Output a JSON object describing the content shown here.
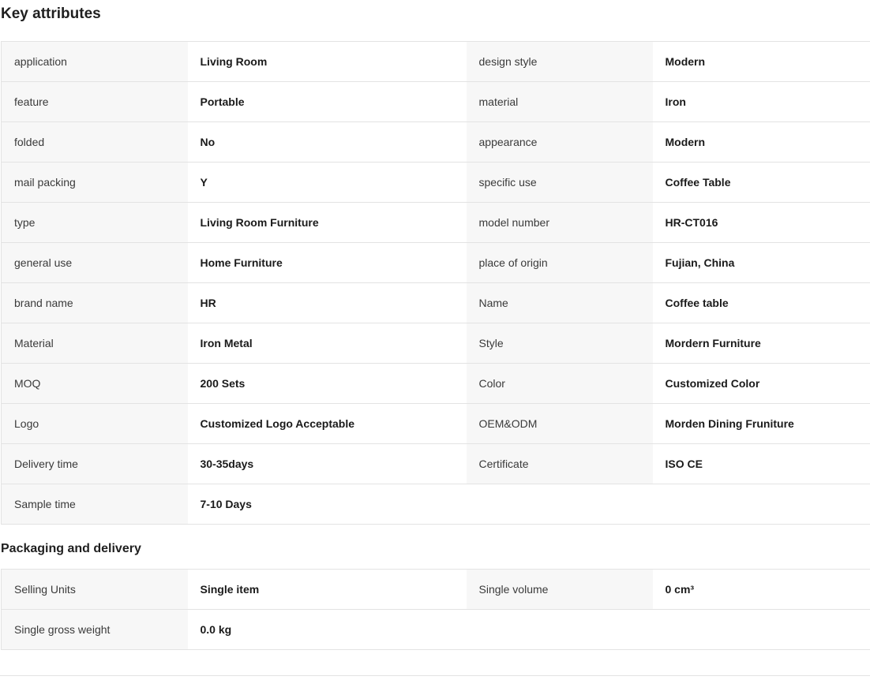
{
  "key_attributes": {
    "title": "Key attributes",
    "rows": [
      [
        {
          "k": "application",
          "v": "Living Room"
        },
        {
          "k": "design style",
          "v": "Modern"
        }
      ],
      [
        {
          "k": "feature",
          "v": "Portable"
        },
        {
          "k": "material",
          "v": "Iron"
        }
      ],
      [
        {
          "k": "folded",
          "v": "No"
        },
        {
          "k": "appearance",
          "v": "Modern"
        }
      ],
      [
        {
          "k": "mail packing",
          "v": "Y"
        },
        {
          "k": "specific use",
          "v": "Coffee Table"
        }
      ],
      [
        {
          "k": "type",
          "v": "Living Room Furniture"
        },
        {
          "k": "model number",
          "v": "HR-CT016"
        }
      ],
      [
        {
          "k": "general use",
          "v": "Home Furniture"
        },
        {
          "k": "place of origin",
          "v": "Fujian, China"
        }
      ],
      [
        {
          "k": "brand name",
          "v": "HR"
        },
        {
          "k": "Name",
          "v": "Coffee table"
        }
      ],
      [
        {
          "k": "Material",
          "v": "Iron Metal"
        },
        {
          "k": "Style",
          "v": "Mordern Furniture"
        }
      ],
      [
        {
          "k": "MOQ",
          "v": "200 Sets"
        },
        {
          "k": "Color",
          "v": "Customized Color"
        }
      ],
      [
        {
          "k": "Logo",
          "v": "Customized Logo Acceptable"
        },
        {
          "k": "OEM&ODM",
          "v": "Morden Dining Fruniture"
        }
      ],
      [
        {
          "k": "Delivery time",
          "v": "30-35days"
        },
        {
          "k": "Certificate",
          "v": "ISO CE"
        }
      ],
      [
        {
          "k": "Sample time",
          "v": "7-10 Days"
        },
        {
          "k": "",
          "v": ""
        }
      ]
    ]
  },
  "packaging": {
    "title": "Packaging and delivery",
    "rows": [
      [
        {
          "k": "Selling Units",
          "v": "Single item"
        },
        {
          "k": "Single volume",
          "v": "0 cm³"
        }
      ],
      [
        {
          "k": "Single gross weight",
          "v": "0.0 kg"
        },
        {
          "k": "",
          "v": ""
        }
      ]
    ]
  }
}
